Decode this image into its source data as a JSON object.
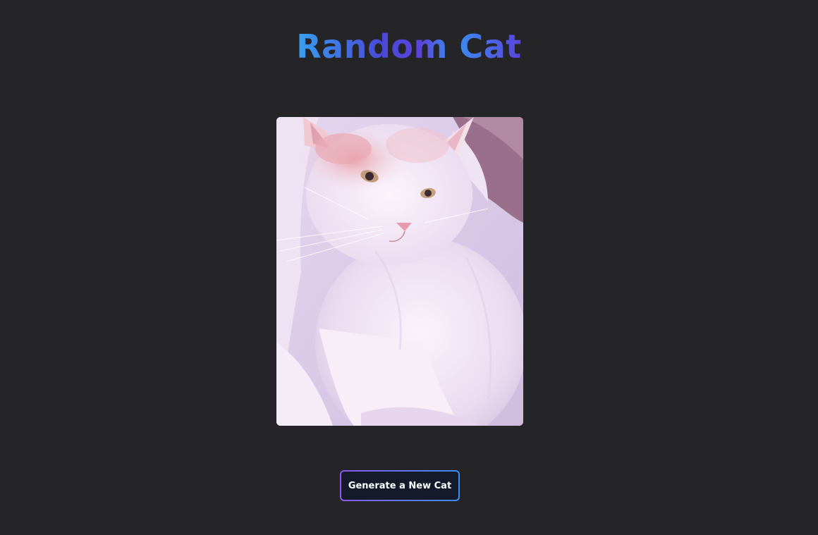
{
  "header": {
    "title": "Random Cat"
  },
  "cat_image": {
    "subject": "cat-photo"
  },
  "actions": {
    "generate_label": "Generate a New Cat"
  },
  "colors": {
    "background": "#252527",
    "title_gradient_start": "#38a0f0",
    "title_gradient_mid": "#4a48d8",
    "button_fill": "#141a2a",
    "button_border_start": "#8a5ae8",
    "button_border_end": "#3b8ff2"
  }
}
